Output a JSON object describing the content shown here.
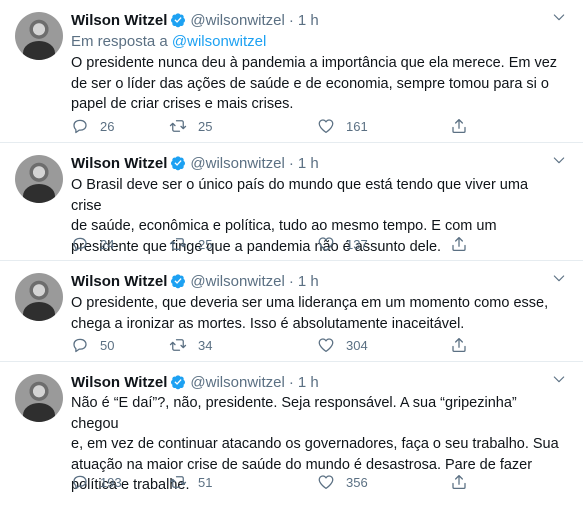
{
  "colors": {
    "accent": "#1da1f2",
    "secondary_text": "#5b7083",
    "divider": "#e6ecf0"
  },
  "icons": {
    "verified": "verified-badge-icon",
    "more": "chevron-down-icon",
    "reply": "reply-bubble-icon",
    "retweet": "retweet-arrows-icon",
    "like": "heart-icon",
    "share": "share-upload-icon"
  },
  "tweets": [
    {
      "author": "Wilson Witzel",
      "handle": "@wilsonwitzel",
      "separator": "·",
      "time": "1 h",
      "reply_prefix": "Em resposta a",
      "reply_handle": "@wilsonwitzel",
      "lines": [
        "O presidente nunca deu à pandemia a importância que ela merece. Em vez",
        "de ser o líder das ações de saúde e de economia, sempre tomou para si o",
        "papel de criar crises e mais crises."
      ],
      "replies": "26",
      "retweets": "25",
      "likes": "161"
    },
    {
      "author": "Wilson Witzel",
      "handle": "@wilsonwitzel",
      "separator": "·",
      "time": "1 h",
      "lines": [
        "O Brasil deve ser o único país do mundo que está tendo que viver uma crise",
        "de saúde, econômica e política, tudo ao mesmo tempo. E com um",
        "presidente que finge que a pandemia não é assunto dele."
      ],
      "replies": "24",
      "retweets": "25",
      "likes": "137"
    },
    {
      "author": "Wilson Witzel",
      "handle": "@wilsonwitzel",
      "separator": "·",
      "time": "1 h",
      "lines": [
        "O presidente, que deveria ser uma liderança em um momento como esse,",
        "chega a ironizar as mortes. Isso é absolutamente inaceitável."
      ],
      "replies": "50",
      "retweets": "34",
      "likes": "304"
    },
    {
      "author": "Wilson Witzel",
      "handle": "@wilsonwitzel",
      "separator": "·",
      "time": "1 h",
      "lines": [
        "Não é “E daí”?, não, presidente. Seja responsável. A sua “gripezinha” chegou",
        "e, em vez de continuar atacando os governadores, faça o seu trabalho. Sua",
        "atuação na maior crise de saúde do mundo é desastrosa. Pare de fazer",
        "política e trabalhe."
      ],
      "replies": "193",
      "retweets": "51",
      "likes": "356"
    }
  ]
}
